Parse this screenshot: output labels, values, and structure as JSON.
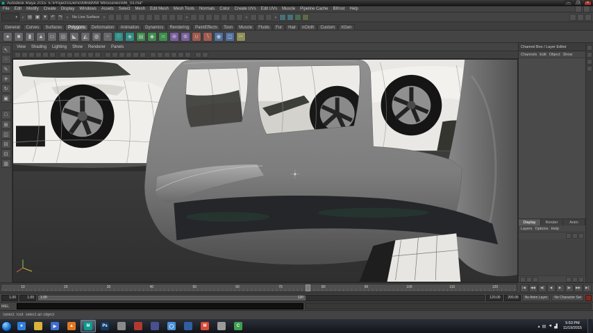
{
  "window": {
    "title": "Autodesk Maya 2015: E:\\Projects\\Demo\\M6\\BMW M6\\scenes\\M6_03.ma*",
    "controls": {
      "minimize": "–",
      "maximize": "❐",
      "close": "✕"
    }
  },
  "menubar": {
    "items": [
      "File",
      "Edit",
      "Modify",
      "Create",
      "Display",
      "Windows",
      "Assets",
      "Select",
      "Mesh",
      "Edit Mesh",
      "Mesh Tools",
      "Normals",
      "Color",
      "Create UVs",
      "Edit UVs",
      "Muscle",
      "Pipeline Cache",
      "Bifrost",
      "Help"
    ],
    "right_icons": [
      {
        "name": "workspace-minimize-icon"
      },
      {
        "name": "workspace-restore-icon"
      }
    ]
  },
  "statusline": {
    "mode_dropdown_glyph": "▾",
    "file_icons": [
      {
        "name": "new-scene-icon",
        "g": "▤"
      },
      {
        "name": "open-scene-icon",
        "g": "▣"
      },
      {
        "name": "save-scene-icon",
        "g": "▼"
      },
      {
        "name": "undo-icon",
        "g": "↶"
      },
      {
        "name": "redo-icon",
        "g": "↷"
      }
    ],
    "live_surface_label": "No Live Surface",
    "mask_icons": [
      {
        "name": "select-hierarchy-icon"
      },
      {
        "name": "select-object-icon"
      },
      {
        "name": "select-component-icon"
      },
      {
        "name": "mask-handles-icon"
      },
      {
        "name": "mask-joints-icon"
      },
      {
        "name": "mask-curves-icon"
      },
      {
        "name": "mask-surfaces-icon"
      },
      {
        "name": "mask-deformations-icon"
      },
      {
        "name": "mask-dynamics-icon"
      },
      {
        "name": "mask-misc-icon"
      }
    ],
    "snap_icons": [
      {
        "name": "snap-grid-icon"
      },
      {
        "name": "snap-curve-icon"
      },
      {
        "name": "snap-point-icon"
      },
      {
        "name": "snap-projected-center-icon"
      },
      {
        "name": "snap-view-plane-icon"
      },
      {
        "name": "make-live-icon"
      },
      {
        "name": "snap-together-icon"
      }
    ],
    "history_icons": [
      {
        "name": "input-connections-icon"
      },
      {
        "name": "output-connections-icon"
      },
      {
        "name": "construction-history-icon"
      }
    ],
    "render_icons": [
      {
        "name": "open-render-view-icon",
        "c": "#46707a"
      },
      {
        "name": "render-current-frame-icon",
        "c": "#46707a"
      },
      {
        "name": "ipr-render-icon",
        "c": "#4a6a52"
      },
      {
        "name": "render-settings-icon",
        "c": "#5d6a46"
      }
    ],
    "right_icons": [
      {
        "name": "sidebar-attribute-editor-toggle"
      },
      {
        "name": "sidebar-tool-settings-toggle"
      },
      {
        "name": "sidebar-channel-box-toggle"
      }
    ]
  },
  "shelf": {
    "tabs": [
      "General",
      "Curves",
      "Surfaces",
      "Polygons",
      "Deformation",
      "Animation",
      "Dynamics",
      "Rendering",
      "PaintEffects",
      "Toon",
      "Muscle",
      "Fluids",
      "Fur",
      "Hair",
      "nCloth",
      "Custom",
      "XGen"
    ],
    "active_tab": "Polygons",
    "icons": [
      {
        "name": "sphere-primitive-icon",
        "g": "●",
        "c": "#67676c"
      },
      {
        "name": "cube-primitive-icon",
        "g": "■",
        "c": "#67676c"
      },
      {
        "name": "cylinder-primitive-icon",
        "g": "▮",
        "c": "#67676c"
      },
      {
        "name": "cone-primitive-icon",
        "g": "▲",
        "c": "#67676c"
      },
      {
        "name": "plane-primitive-icon",
        "g": "▭",
        "c": "#67676c"
      },
      {
        "name": "torus-primitive-icon",
        "g": "◎",
        "c": "#67676c"
      },
      {
        "name": "prism-primitive-icon",
        "g": "◣",
        "c": "#67676c"
      },
      {
        "name": "pyramid-primitive-icon",
        "g": "◭",
        "c": "#67676c"
      },
      {
        "name": "pipe-primitive-icon",
        "g": "◍",
        "c": "#67676c"
      },
      {
        "name": "helix-primitive-icon",
        "g": "~",
        "c": "#67676c"
      },
      {
        "name": "soccer-ball-icon",
        "g": "☉",
        "c": "#2e8f86"
      },
      {
        "name": "platonic-solid-icon",
        "g": "◈",
        "c": "#2e8f86"
      },
      {
        "name": "extrude-icon",
        "g": "▤",
        "c": "#3c8f4e"
      },
      {
        "name": "bevel-icon",
        "g": "◆",
        "c": "#3c8f4e"
      },
      {
        "name": "bridge-icon",
        "g": "≍",
        "c": "#3c8f4e"
      },
      {
        "name": "combine-icon",
        "g": "⊕",
        "c": "#7a5fa0"
      },
      {
        "name": "separate-icon",
        "g": "⊗",
        "c": "#7a5fa0"
      },
      {
        "name": "boolean-union-icon",
        "g": "∪",
        "c": "#a05b50"
      },
      {
        "name": "boolean-difference-icon",
        "g": "∖",
        "c": "#a05b50"
      },
      {
        "name": "smooth-icon",
        "g": "◉",
        "c": "#4f6fa0"
      },
      {
        "name": "mirror-icon",
        "g": "◫",
        "c": "#4f6fa0"
      },
      {
        "name": "multi-cut-icon",
        "g": "✂",
        "c": "#8f8f5a"
      }
    ]
  },
  "toolbox": {
    "tools": [
      {
        "name": "select-tool-icon",
        "g": "↖"
      },
      {
        "name": "lasso-tool-icon",
        "g": "◌"
      },
      {
        "name": "paint-select-tool-icon",
        "g": "✎"
      },
      {
        "name": "move-tool-icon",
        "g": "✛"
      },
      {
        "name": "rotate-tool-icon",
        "g": "↻"
      },
      {
        "name": "scale-tool-icon",
        "g": "▣"
      }
    ],
    "layouts": [
      {
        "name": "single-pane-layout-button",
        "g": "□"
      },
      {
        "name": "four-pane-layout-button",
        "g": "⊞"
      },
      {
        "name": "persp-outliner-layout-button",
        "g": "◫"
      },
      {
        "name": "top-persp-layout-button",
        "g": "⊟"
      },
      {
        "name": "persp-graph-layout-button",
        "g": "⊡"
      },
      {
        "name": "hypershade-layout-button",
        "g": "▥"
      }
    ]
  },
  "viewport": {
    "menus": [
      "View",
      "Shading",
      "Lighting",
      "Show",
      "Renderer",
      "Panels"
    ],
    "icons": [
      {
        "name": "camera-icon"
      },
      {
        "name": "bookmarks-icon"
      },
      {
        "name": "image-plane-icon"
      },
      {
        "name": "2d-pan-zoom-icon"
      },
      {
        "name": "grease-pencil-icon"
      },
      {
        "name": "grid-toggle-icon"
      },
      {
        "name": "film-gate-icon"
      },
      {
        "name": "resolution-gate-icon"
      },
      {
        "name": "gate-mask-icon"
      },
      {
        "name": "field-chart-icon"
      },
      {
        "name": "safe-action-icon"
      },
      {
        "name": "safe-title-icon"
      },
      {
        "name": "fill-mode-icon"
      },
      {
        "name": "wireframe-mode-icon"
      },
      {
        "name": "shaded-mode-icon"
      },
      {
        "name": "textured-mode-icon"
      },
      {
        "name": "use-all-lights-icon"
      },
      {
        "name": "shadows-icon"
      },
      {
        "name": "screen-space-ao-icon"
      },
      {
        "name": "motion-blur-icon"
      },
      {
        "name": "multisample-aa-icon"
      },
      {
        "name": "depth-of-field-icon"
      },
      {
        "name": "isolate-select-icon"
      },
      {
        "name": "xray-icon"
      },
      {
        "name": "wireframe-on-shaded-icon"
      },
      {
        "name": "default-material-icon"
      }
    ]
  },
  "channel_box": {
    "header": "Channel Box / Layer Editor",
    "menus": [
      "Channels",
      "Edit",
      "Object",
      "Show"
    ],
    "layer_editor": {
      "tabs": [
        "Display",
        "Render",
        "Anim"
      ],
      "active_tab": "Display",
      "menus": [
        "Layers",
        "Options",
        "Help"
      ],
      "toolbar_icons": [
        {
          "name": "move-layer-up-icon"
        },
        {
          "name": "new-empty-layer-icon"
        },
        {
          "name": "new-layer-from-selected-icon"
        }
      ],
      "bottom_left_icons": [
        {
          "name": "layer-sort-icon"
        },
        {
          "name": "layer-filter-icon"
        },
        {
          "name": "layer-options-icon"
        }
      ],
      "bottom_right_icons": [
        {
          "name": "scroll-left-icon"
        },
        {
          "name": "scroll-right-icon"
        },
        {
          "name": "panel-resize-icon"
        }
      ]
    }
  },
  "right_strip": {
    "icons": [
      {
        "name": "attribute-editor-tab"
      },
      {
        "name": "tool-settings-tab"
      },
      {
        "name": "channel-box-tab"
      },
      {
        "name": "modeling-toolkit-tab"
      }
    ]
  },
  "time_slider": {
    "labels": [
      "10",
      "20",
      "30",
      "40",
      "50",
      "60",
      "70",
      "80",
      "90",
      "100",
      "110",
      "120"
    ]
  },
  "transport": {
    "buttons": [
      {
        "name": "go-to-start-button",
        "g": "|◀"
      },
      {
        "name": "step-back-frame-button",
        "g": "◀◀"
      },
      {
        "name": "step-back-key-button",
        "g": "◀|"
      },
      {
        "name": "play-backwards-button",
        "g": "◀"
      },
      {
        "name": "play-forwards-button",
        "g": "▶"
      },
      {
        "name": "step-forward-key-button",
        "g": "|▶"
      },
      {
        "name": "step-forward-frame-button",
        "g": "▶▶"
      },
      {
        "name": "go-to-end-button",
        "g": "▶|"
      }
    ]
  },
  "range_slider": {
    "playback_start": "1.00",
    "anim_start": "1.00",
    "bar_start": "1.00",
    "bar_end": "120",
    "playback_end": "120.00",
    "anim_end": "200.00",
    "anim_layer_label": "No Anim Layer",
    "character_set_label": "No Character Set"
  },
  "command_line": {
    "label": "MEL"
  },
  "help_line": {
    "text": "Select Tool: select an object"
  },
  "taskbar": {
    "apps": [
      {
        "name": "internet-explorer-icon",
        "c": "#2f7fd6",
        "g": "e"
      },
      {
        "name": "explorer-folder-icon",
        "c": "#d9b13b",
        "g": ""
      },
      {
        "name": "media-player-icon",
        "c": "#3f6fd0",
        "g": "▶"
      },
      {
        "name": "vlc-icon",
        "c": "#e07820",
        "g": "▲"
      },
      {
        "name": "maya-icon",
        "c": "#0f9b8e",
        "g": "M"
      },
      {
        "name": "photoshop-icon",
        "c": "#123a63",
        "g": "Ps"
      },
      {
        "name": "app-icon-7",
        "c": "#8a8a8a",
        "g": ""
      },
      {
        "name": "app-icon-8",
        "c": "#b03a30",
        "g": ""
      },
      {
        "name": "app-icon-9",
        "c": "#4a4f8f",
        "g": ""
      },
      {
        "name": "browser-icon",
        "c": "#4a90d9",
        "g": "◯"
      },
      {
        "name": "app-icon-11",
        "c": "#2f5fa0",
        "g": ""
      },
      {
        "name": "mail-icon",
        "c": "#d94a3a",
        "g": "M"
      },
      {
        "name": "utility-wrench-icon",
        "c": "#9a9a9a",
        "g": ""
      },
      {
        "name": "app-icon-14",
        "c": "#3f9f4f",
        "g": "C"
      }
    ],
    "tray": [
      {
        "name": "tray-expand-icon",
        "g": "▴"
      },
      {
        "name": "tray-app-icon",
        "g": "▤"
      },
      {
        "name": "volume-icon",
        "g": "◄"
      },
      {
        "name": "network-icon",
        "g": "▟"
      }
    ],
    "clock": {
      "time": "5:53 PM",
      "date": "11/19/2015"
    }
  }
}
